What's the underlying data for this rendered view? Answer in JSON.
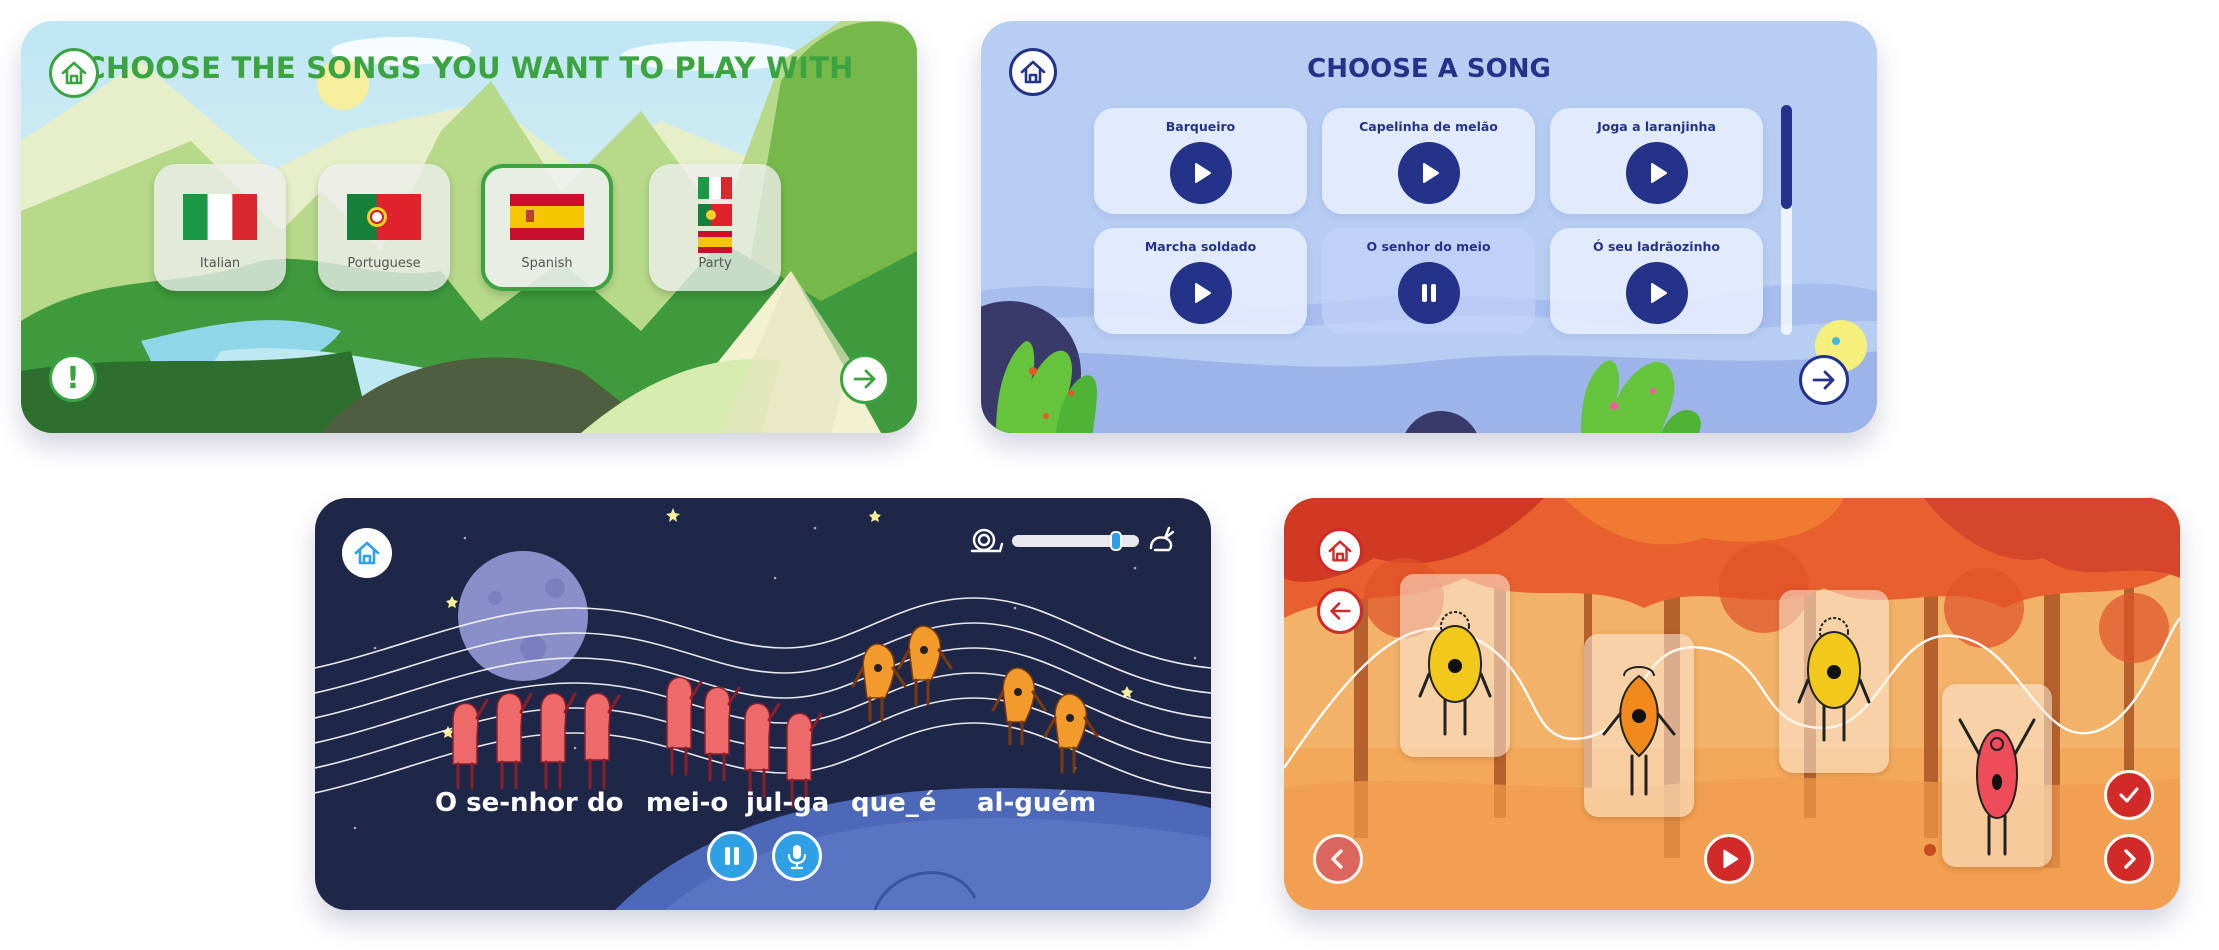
{
  "screen_language": {
    "title": "CHOOSE THE SONGS YOU WANT TO PLAY WITH",
    "languages": [
      {
        "label": "Italian",
        "selected": false
      },
      {
        "label": "Portuguese",
        "selected": false
      },
      {
        "label": "Spanish",
        "selected": true
      },
      {
        "label": "Party",
        "selected": false
      }
    ],
    "accent_color": "#3ca341",
    "icons": [
      "home-icon",
      "alert-icon",
      "arrow-right-icon"
    ]
  },
  "screen_song": {
    "title": "CHOOSE A SONG",
    "songs": [
      {
        "label": "Barqueiro",
        "state": "play"
      },
      {
        "label": "Capelinha de melão",
        "state": "play"
      },
      {
        "label": "Joga a laranjinha",
        "state": "play"
      },
      {
        "label": "Marcha soldado",
        "state": "play"
      },
      {
        "label": "O senhor do meio",
        "state": "pause"
      },
      {
        "label": "Ó seu ladrãozinho",
        "state": "play"
      }
    ],
    "accent_color": "#24328a",
    "icons": [
      "home-icon",
      "play-icon",
      "pause-icon",
      "arrow-right-icon"
    ]
  },
  "screen_karaoke": {
    "lyrics": [
      {
        "text": "O se-nhor",
        "sung": true
      },
      {
        "text": "do",
        "sung": true
      },
      {
        "text": "mei-o",
        "sung": true
      },
      {
        "text": "jul-ga",
        "sung": true
      },
      {
        "text": "que_é",
        "sung": false
      },
      {
        "text": "al-guém",
        "sung": false
      }
    ],
    "speed_level": 0.85,
    "colors": {
      "sung": "#6fc6f3",
      "unsung": "#ffffff",
      "accent": "#2f9fe6"
    },
    "icons": [
      "home-icon",
      "snail-icon",
      "rabbit-icon",
      "pause-icon",
      "microphone-icon"
    ]
  },
  "screen_sequence": {
    "accent_color": "#d12a28",
    "character_colors": [
      "#f2c81b",
      "#f2891b",
      "#f2c81b",
      "#ee4b5b"
    ],
    "icons": [
      "home-icon",
      "arrow-left-icon",
      "play-icon",
      "check-icon",
      "chevron-left-icon",
      "chevron-right-icon"
    ]
  }
}
